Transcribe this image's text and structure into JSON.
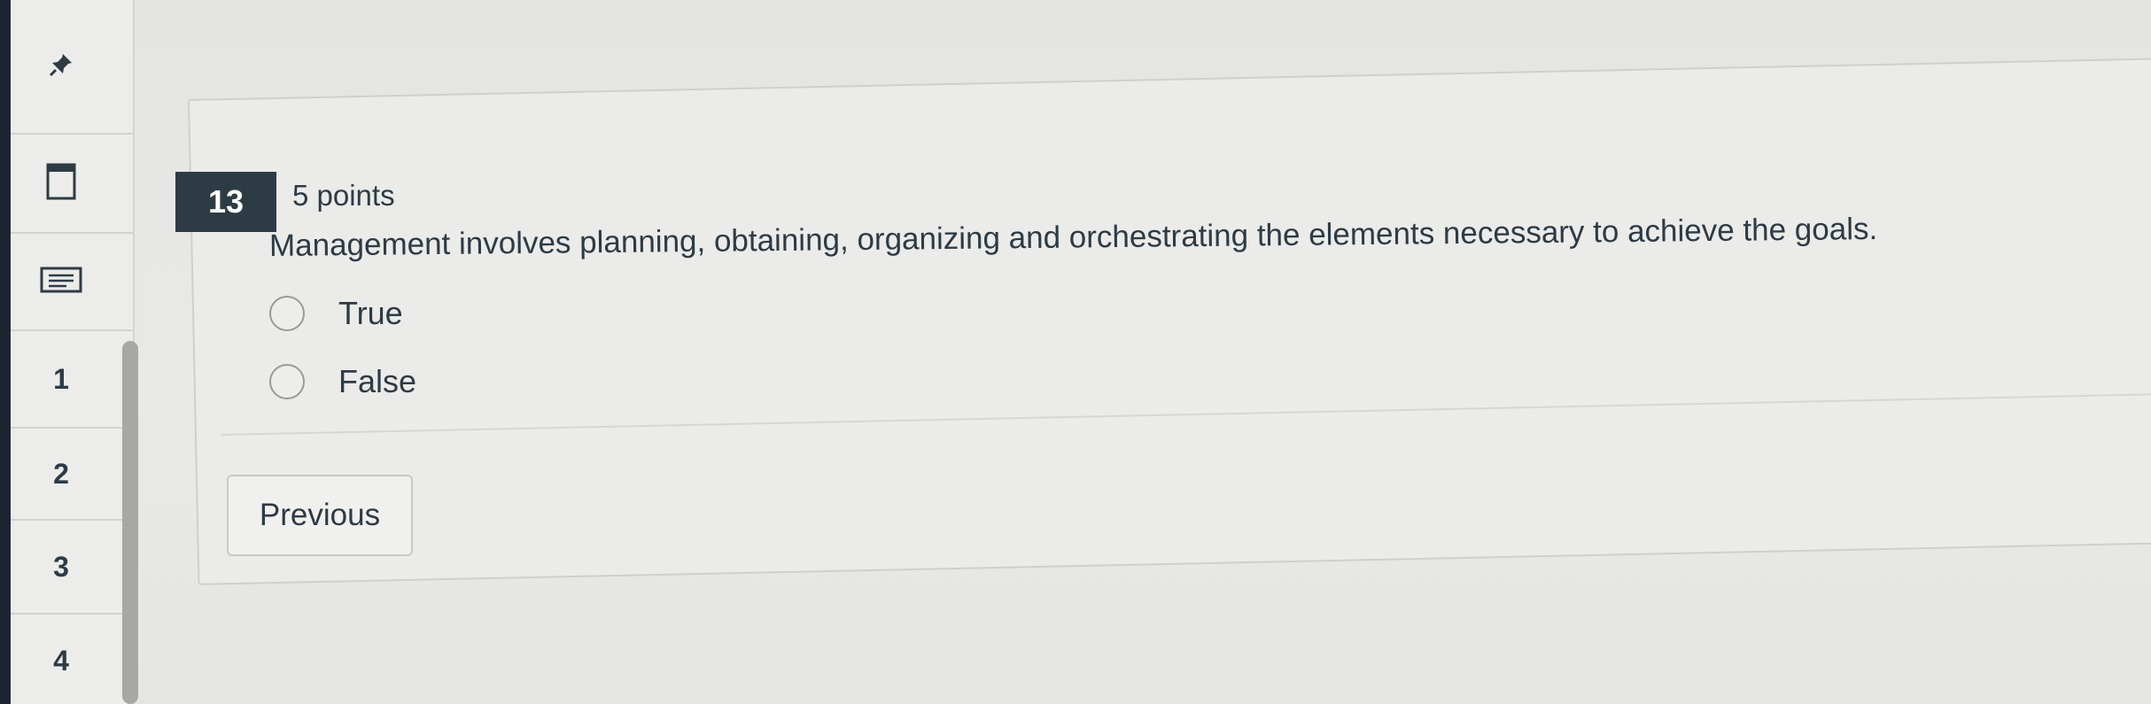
{
  "sidebar": {
    "icons": [
      "pin-icon",
      "flag-icon",
      "notes-icon"
    ],
    "items": [
      {
        "label": "1"
      },
      {
        "label": "2"
      },
      {
        "label": "3"
      },
      {
        "label": "4"
      }
    ]
  },
  "question": {
    "number": "13",
    "points": "5 points",
    "text": "Management involves planning, obtaining, organizing and orchestrating the elements necessary to achieve the goals.",
    "answers": [
      {
        "label": "True"
      },
      {
        "label": "False"
      }
    ]
  },
  "nav": {
    "previous_label": "Previous"
  }
}
